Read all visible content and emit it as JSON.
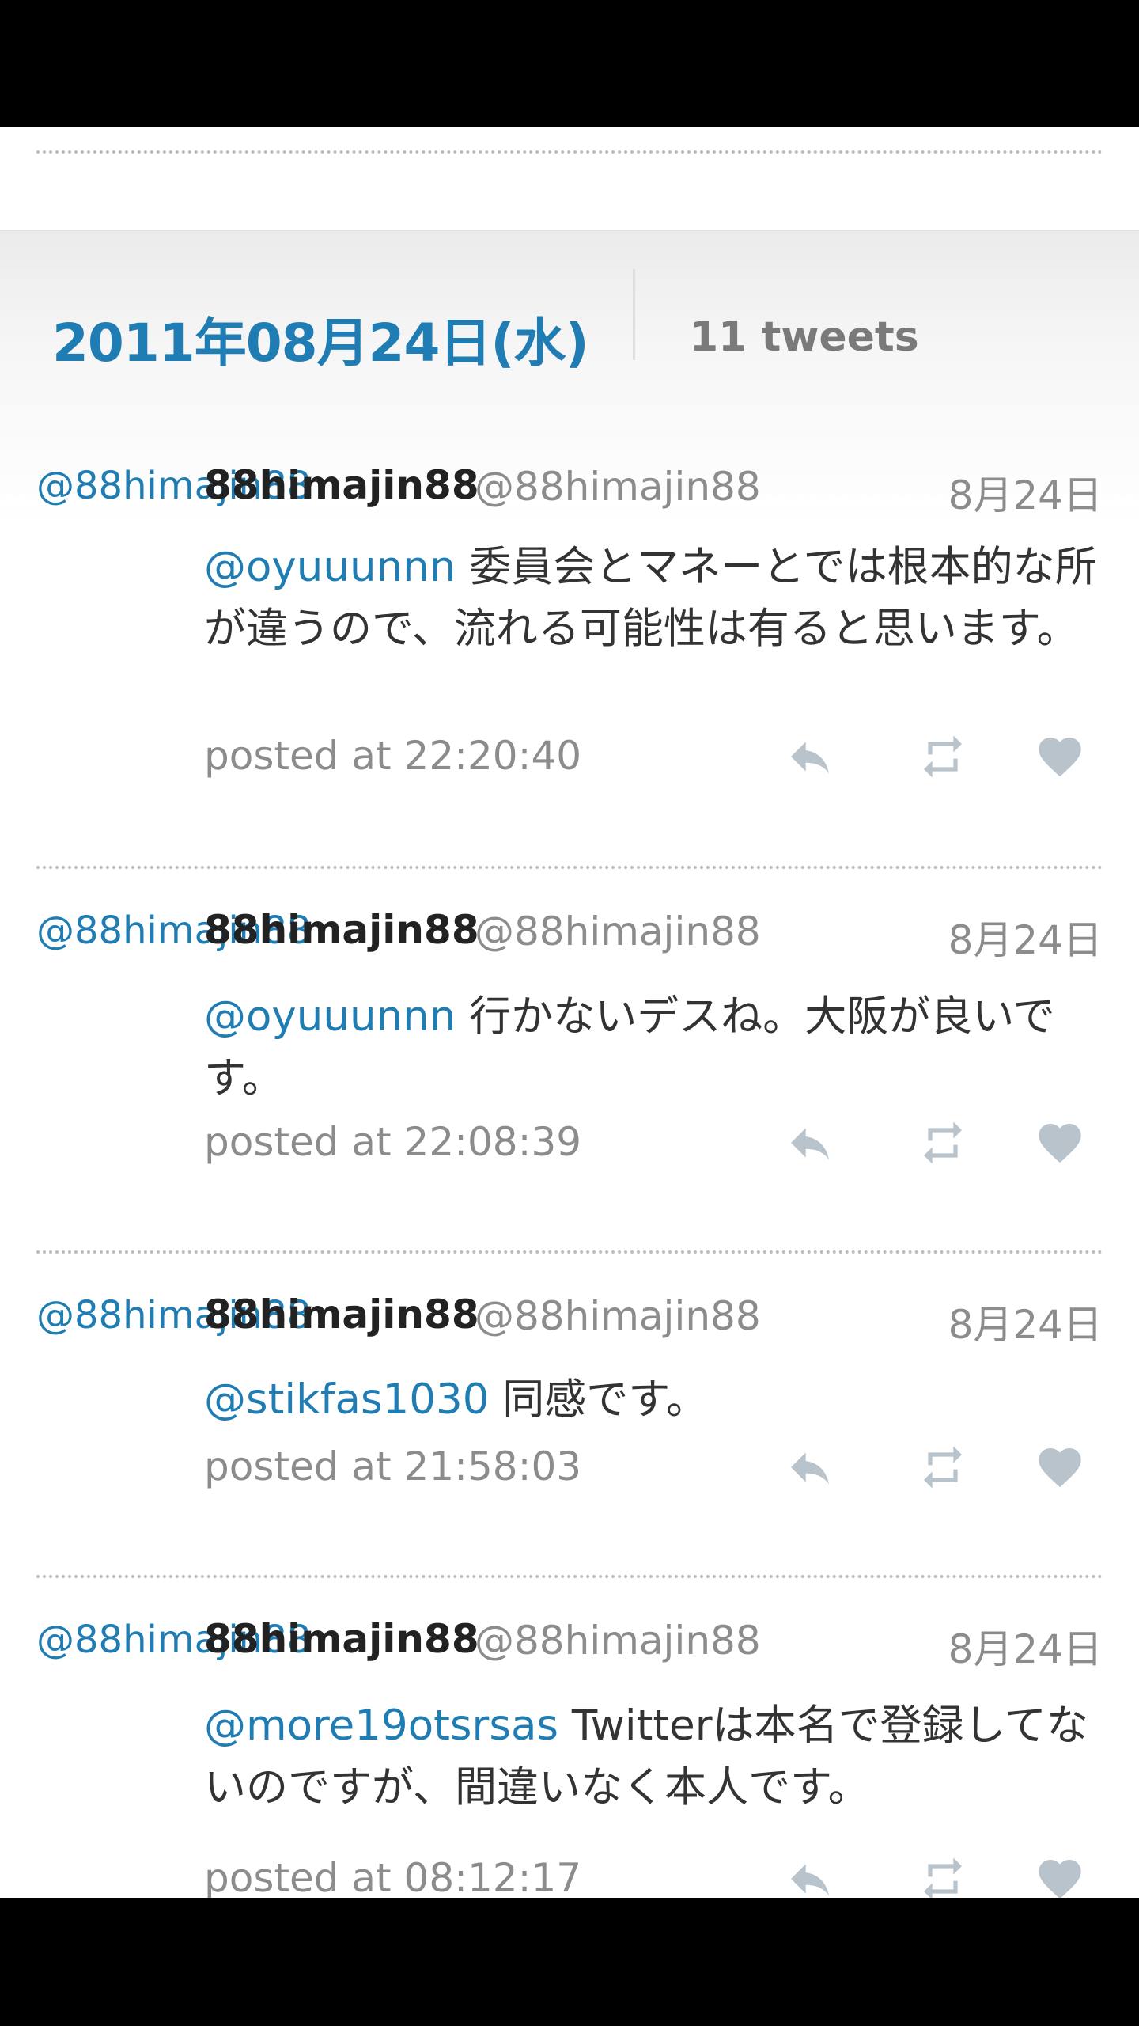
{
  "day": {
    "title": "2011年08月24日(水)",
    "count": "11 tweets"
  },
  "colors": {
    "accent": "#1f7db3",
    "muted": "#8c8c8c",
    "icon": "#b9c3cc"
  },
  "tweets": [
    {
      "avatar_alt": "@88himajin88",
      "name": "88himajin88",
      "handle": "@88himajin88",
      "date": "8月24日",
      "mention": "@oyuuunnn",
      "text": " 委員会とマネーとでは根本的な所が違うので、流れる可能性は有ると思います。",
      "posted": "posted at 22:20:40"
    },
    {
      "avatar_alt": "@88himajin88",
      "name": "88himajin88",
      "handle": "@88himajin88",
      "date": "8月24日",
      "mention": "@oyuuunnn",
      "text": " 行かないデスね。大阪が良いです。",
      "posted": "posted at 22:08:39"
    },
    {
      "avatar_alt": "@88himajin88",
      "name": "88himajin88",
      "handle": "@88himajin88",
      "date": "8月24日",
      "mention": "@stikfas1030",
      "text": " 同感です。",
      "posted": "posted at 21:58:03"
    },
    {
      "avatar_alt": "@88himajin88",
      "name": "88himajin88",
      "handle": "@88himajin88",
      "date": "8月24日",
      "mention": "@more19otsrsas",
      "text": " Twitterは本名で登録してないのですが、間違いなく本人です。",
      "posted": "posted at 08:12:17"
    }
  ],
  "icons": {
    "reply": "reply-icon",
    "retweet": "retweet-icon",
    "favorite": "heart-icon"
  }
}
